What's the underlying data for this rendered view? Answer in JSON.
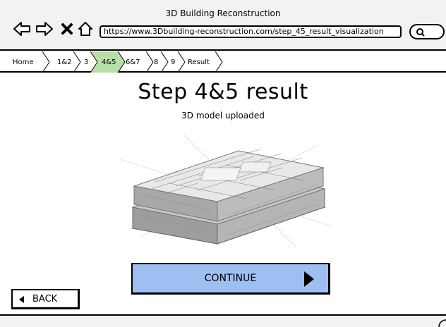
{
  "window": {
    "title": "3D Building Reconstruction"
  },
  "browser": {
    "url": "https://www.3Dbuilding-reconstruction.com/step_45_result_visualization",
    "back_icon": "arrow-left-icon",
    "forward_icon": "arrow-right-icon",
    "stop_icon": "close-icon",
    "home_icon": "home-icon",
    "search_icon": "search-icon"
  },
  "breadcrumb": {
    "items": [
      {
        "label": "Home",
        "active": false
      },
      {
        "label": "1&2",
        "active": false
      },
      {
        "label": "3",
        "active": false
      },
      {
        "label": "4&5",
        "active": true
      },
      {
        "label": "6&7",
        "active": false
      },
      {
        "label": "8",
        "active": false
      },
      {
        "label": "9",
        "active": false
      },
      {
        "label": "Result",
        "active": false
      }
    ],
    "active_color": "#b9dfa8"
  },
  "main": {
    "title": "Step 4&5 result",
    "subtitle": "3D model uploaded"
  },
  "buttons": {
    "continue_label": "CONTINUE",
    "continue_color": "#9ebff1",
    "back_label": "BACK"
  }
}
